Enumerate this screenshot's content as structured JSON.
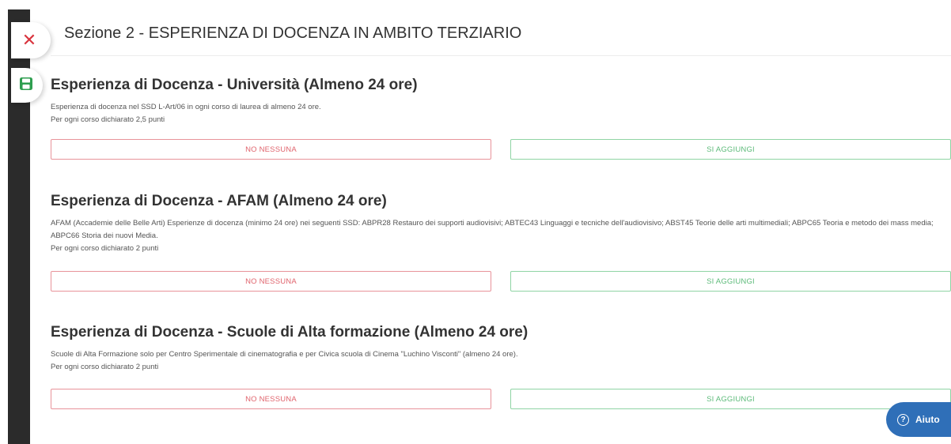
{
  "section": {
    "title": "Sezione 2 - ESPERIENZA DI DOCENZA IN AMBITO TERZIARIO"
  },
  "sidebar": {
    "close_icon": "close-icon",
    "save_icon": "save-icon"
  },
  "blocks": [
    {
      "title": "Esperienza di Docenza - Università (Almeno 24 ore)",
      "description": "Esperienza di docenza nel SSD L-Art/06 in ogni corso di laurea di almeno 24 ore.",
      "points": "Per ogni corso dichiarato 2,5 punti",
      "no_label": "NO NESSUNA",
      "si_label": "SI AGGIUNGI"
    },
    {
      "title": "Esperienza di Docenza - AFAM (Almeno 24 ore)",
      "description": "AFAM (Accademie delle Belle Arti) Esperienze di docenza (minimo 24 ore) nei seguenti SSD: ABPR28 Restauro dei supporti audiovisivi; ABTEC43 Linguaggi e tecniche dell'audiovisivo; ABST45 Teorie delle arti multimediali; ABPC65 Teoria e metodo dei mass media; ABPC66 Storia dei nuovi Media.",
      "points": "Per ogni corso dichiarato 2 punti",
      "no_label": "NO NESSUNA",
      "si_label": "SI AGGIUNGI"
    },
    {
      "title": "Esperienza di Docenza - Scuole di Alta formazione (Almeno 24 ore)",
      "description": "Scuole di Alta Formazione solo per Centro Sperimentale di cinematografia e per Civica scuola di Cinema \"Luchino Visconti\" (almeno 24 ore).",
      "points": "Per ogni corso dichiarato 2 punti",
      "no_label": "NO NESSUNA",
      "si_label": "SI AGGIUNGI"
    }
  ],
  "help": {
    "label": "Aiuto",
    "icon": "question-circle-icon"
  },
  "colors": {
    "no_button": "#e0646d",
    "si_button": "#5dbb7a",
    "close_icon": "#d9343e",
    "save_icon": "#2e9e4f",
    "help_button": "#2f6fb8",
    "left_bar": "#2b2b2b"
  }
}
